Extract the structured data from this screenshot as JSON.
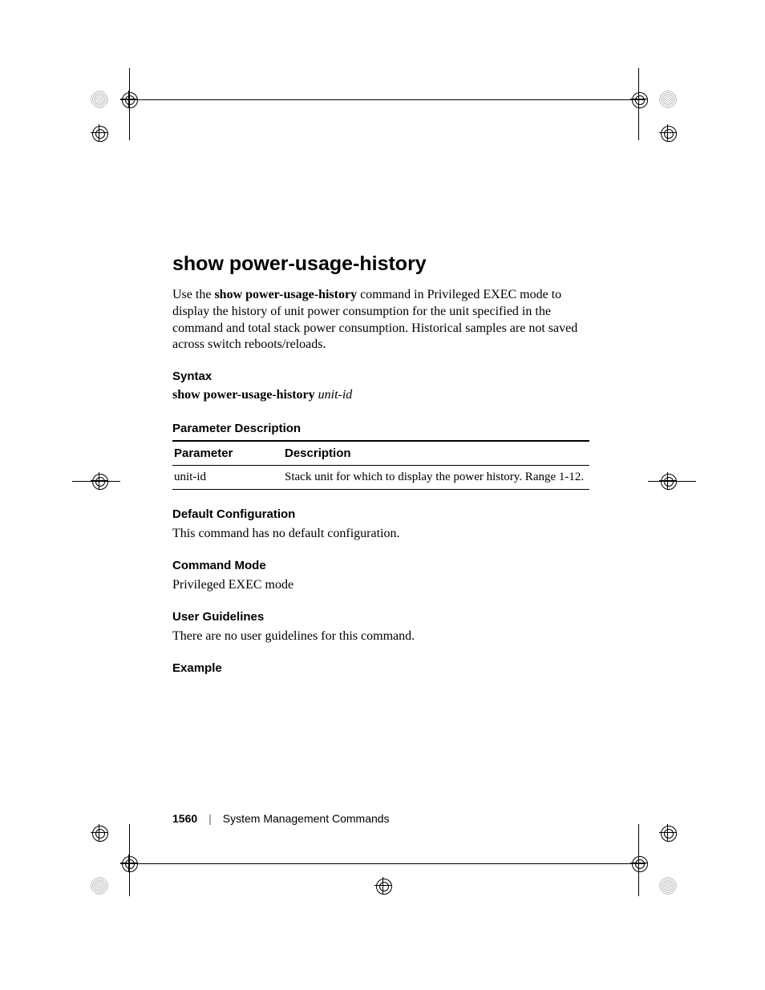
{
  "title": "show power-usage-history",
  "intro": {
    "pre": "Use the ",
    "bold": "show power-usage-history",
    "post": " command in Privileged EXEC mode to display the history of unit power consumption for the unit specified in the command and total stack power consumption. Historical samples are not saved across switch reboots/reloads."
  },
  "sections": {
    "syntax": {
      "heading": "Syntax",
      "cmd_bold": "show power-usage-history",
      "cmd_italic": "unit-id"
    },
    "param_desc": {
      "heading": "Parameter Description",
      "headers": {
        "c1": "Parameter",
        "c2": "Description"
      },
      "rows": [
        {
          "c1": "unit-id",
          "c2": "Stack unit for which to display the power history. Range 1-12."
        }
      ]
    },
    "default_cfg": {
      "heading": "Default Configuration",
      "body": "This command has no default configuration."
    },
    "cmd_mode": {
      "heading": "Command Mode",
      "body": "Privileged EXEC mode"
    },
    "user_guidelines": {
      "heading": "User Guidelines",
      "body": "There are no user guidelines for this command."
    },
    "example": {
      "heading": "Example"
    }
  },
  "footer": {
    "page_number": "1560",
    "separator": "|",
    "chapter": "System Management Commands"
  }
}
